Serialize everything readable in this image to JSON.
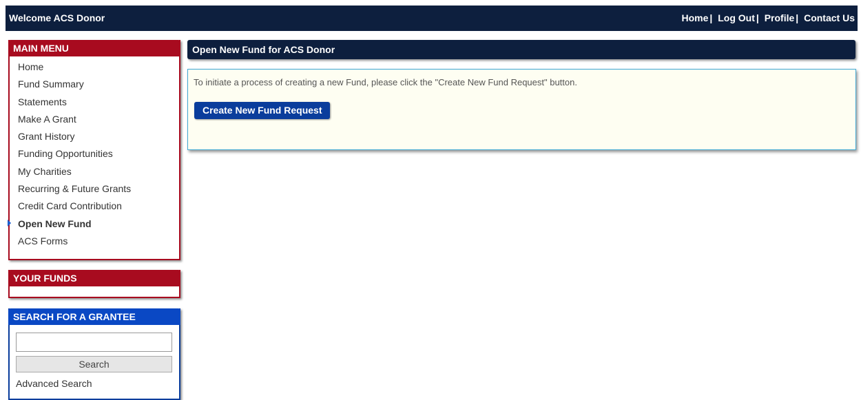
{
  "header": {
    "welcome": "Welcome ACS Donor",
    "links": [
      "Home",
      "Log Out",
      "Profile",
      "Contact Us"
    ],
    "separator": "|"
  },
  "main_menu": {
    "title": "MAIN MENU",
    "items": [
      {
        "label": "Home"
      },
      {
        "label": "Fund Summary"
      },
      {
        "label": "Statements"
      },
      {
        "label": "Make A Grant"
      },
      {
        "label": "Grant History"
      },
      {
        "label": "Funding Opportunities"
      },
      {
        "label": "My Charities"
      },
      {
        "label": "Recurring & Future Grants"
      },
      {
        "label": "Credit Card Contribution"
      },
      {
        "label": "Open New Fund"
      },
      {
        "label": "ACS Forms"
      }
    ],
    "active_item": "Open New Fund"
  },
  "your_funds": {
    "title": "YOUR FUNDS"
  },
  "search": {
    "title": "SEARCH FOR A GRANTEE",
    "input_value": "",
    "button_label": "Search",
    "advanced_link": "Advanced Search"
  },
  "content": {
    "title": "Open New Fund for ACS Donor",
    "instruction": "To initiate a process of creating a new Fund, please click the \"Create New Fund Request\" button.",
    "button_label": "Create New Fund Request"
  },
  "colors": {
    "header_navy": "#0d1f3e",
    "menu_red": "#a80b1f",
    "search_blue": "#0a48c4",
    "button_blue": "#0a3d9c",
    "content_bg": "#fefef2"
  }
}
